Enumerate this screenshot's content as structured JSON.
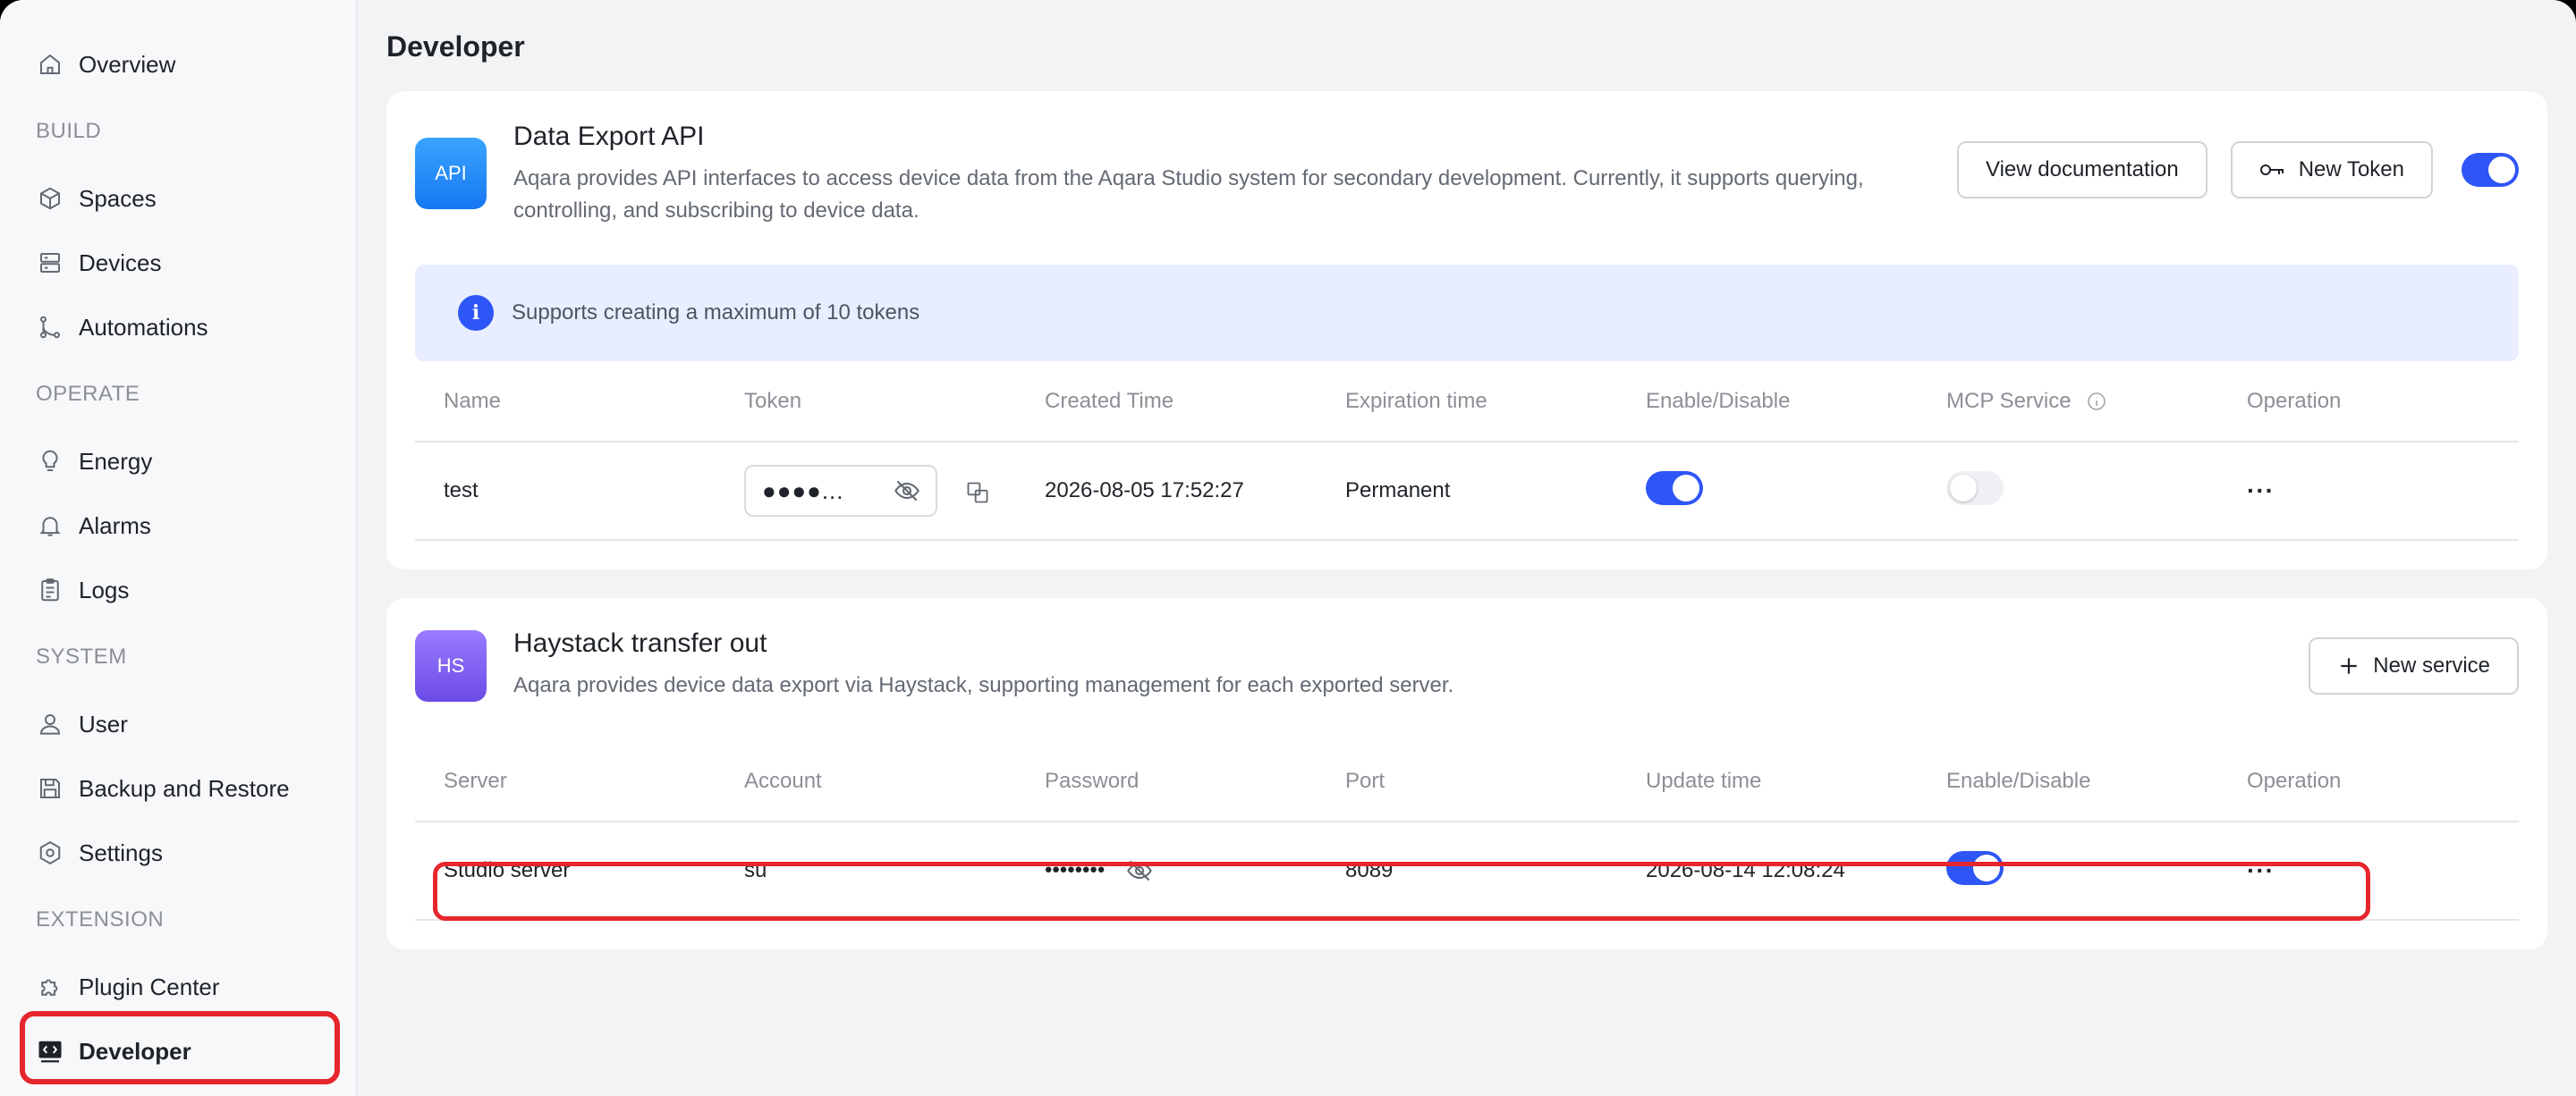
{
  "page": {
    "title": "Developer"
  },
  "sidebar": {
    "items": [
      {
        "type": "item",
        "label": "Overview",
        "icon": "home-icon"
      },
      {
        "type": "section",
        "label": "BUILD"
      },
      {
        "type": "item",
        "label": "Spaces",
        "icon": "cube-icon"
      },
      {
        "type": "item",
        "label": "Devices",
        "icon": "server-icon"
      },
      {
        "type": "item",
        "label": "Automations",
        "icon": "flow-icon"
      },
      {
        "type": "section",
        "label": "OPERATE"
      },
      {
        "type": "item",
        "label": "Energy",
        "icon": "bulb-icon"
      },
      {
        "type": "item",
        "label": "Alarms",
        "icon": "bell-icon"
      },
      {
        "type": "item",
        "label": "Logs",
        "icon": "clipboard-icon"
      },
      {
        "type": "section",
        "label": "SYSTEM"
      },
      {
        "type": "item",
        "label": "User",
        "icon": "user-icon"
      },
      {
        "type": "item",
        "label": "Backup and Restore",
        "icon": "save-icon"
      },
      {
        "type": "item",
        "label": "Settings",
        "icon": "gear-icon"
      },
      {
        "type": "section",
        "label": "EXTENSION"
      },
      {
        "type": "item",
        "label": "Plugin Center",
        "icon": "puzzle-icon"
      },
      {
        "type": "item",
        "label": "Developer",
        "icon": "code-icon",
        "active": true
      }
    ]
  },
  "api_card": {
    "badge": "API",
    "title": "Data Export API",
    "description": "Aqara provides API interfaces to access device data from the Aqara Studio system for secondary development. Currently, it supports querying, controlling, and subscribing to device data.",
    "view_docs_label": "View documentation",
    "new_token_label": "New Token",
    "enabled": true,
    "notice": "Supports creating a maximum of 10 tokens",
    "columns": [
      "Name",
      "Token",
      "Created Time",
      "Expiration time",
      "Enable/Disable",
      "MCP Service",
      "Operation"
    ],
    "rows": [
      {
        "name": "test",
        "token": "●●●●...",
        "created": "2026-08-05 17:52:27",
        "expiration": "Permanent",
        "enabled": true,
        "mcp": false,
        "operation": "···"
      }
    ]
  },
  "hs_card": {
    "badge": "HS",
    "title": "Haystack transfer out",
    "description": "Aqara provides device data export via Haystack, supporting management for each exported server.",
    "new_service_label": "New service",
    "columns": [
      "Server",
      "Account",
      "Password",
      "Port",
      "Update time",
      "Enable/Disable",
      "Operation"
    ],
    "rows": [
      {
        "server": "Studio server",
        "account": "su",
        "password": "••••••••",
        "port": "8089",
        "updated": "2026-08-14 12:08:24",
        "enabled": true,
        "operation": "···"
      }
    ]
  },
  "colors": {
    "accent": "#2e55f6",
    "highlight": "#e5262c"
  }
}
